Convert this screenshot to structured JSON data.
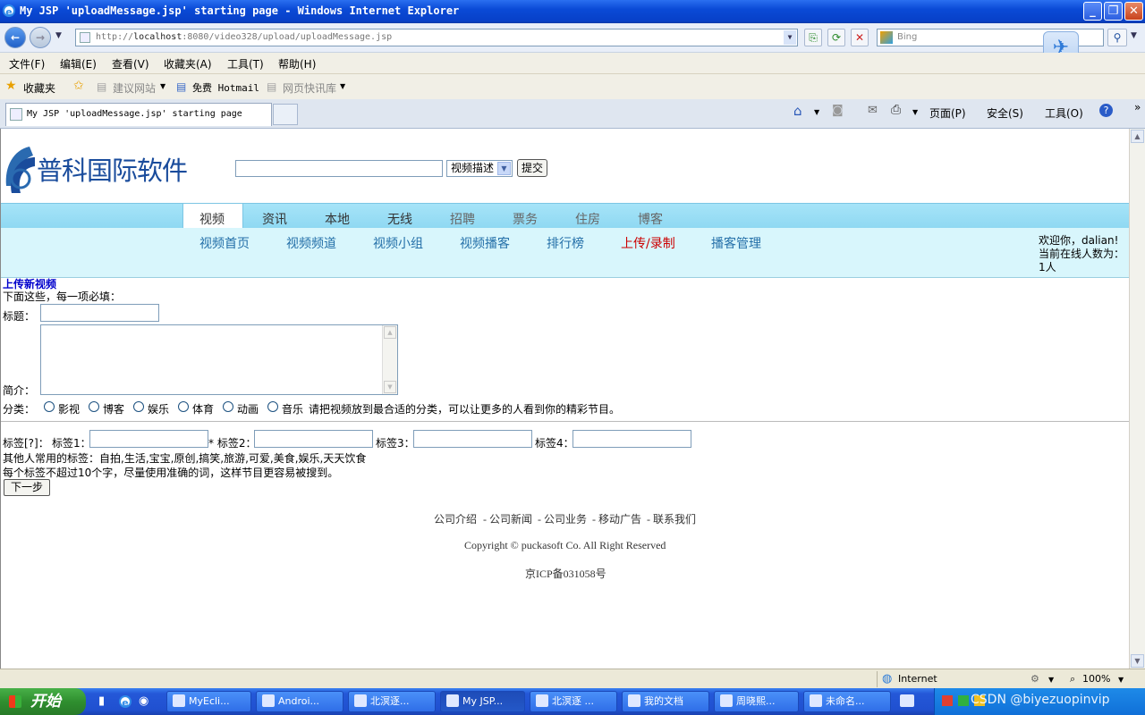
{
  "window": {
    "title": "My JSP 'uploadMessage.jsp' starting page - Windows Internet Explorer"
  },
  "address": {
    "url_prefix": "http://",
    "url_host": "localhost",
    "url_rest": ":8080/video328/upload/uploadMessage.jsp",
    "search_placeholder": "Bing"
  },
  "menubar": [
    "文件(F)",
    "编辑(E)",
    "查看(V)",
    "收藏夹(A)",
    "工具(T)",
    "帮助(H)"
  ],
  "favbar": {
    "favorites": "收藏夹",
    "suggested": "建议网站",
    "hotmail": "免费 Hotmail",
    "webslice": "网页快讯库"
  },
  "tab": {
    "title": "My JSP 'uploadMessage.jsp' starting page"
  },
  "cmdbar": {
    "page": "页面(P)",
    "safety": "安全(S)",
    "tools": "工具(O)"
  },
  "site": {
    "logo_text": "普科国际软件",
    "search_select": "视频描述",
    "search_submit": "提交",
    "main_nav": [
      "视频",
      "资讯",
      "本地",
      "无线",
      "招聘",
      "票务",
      "住房",
      "博客"
    ],
    "sub_nav": [
      "视频首页",
      "视频频道",
      "视频小组",
      "视频播客",
      "排行榜",
      "上传/录制",
      "播客管理"
    ],
    "welcome": "欢迎你，dalian! 当前在线人数为：1人",
    "colors": {
      "nav_band": "#96dcf4",
      "sub_band": "#d8f6fc",
      "sub_link": "#236fa8",
      "sub_active": "#cc0000",
      "heading": "#0000cc"
    }
  },
  "form": {
    "heading": "上传新视频",
    "note": "下面这些，每一项必填：",
    "title_label": "标题：",
    "intro_label": "简介：",
    "category_label": "分类：",
    "categories": [
      "影视",
      "博客",
      "娱乐",
      "体育",
      "动画",
      "音乐"
    ],
    "category_hint": "请把视频放到最合适的分类，可以让更多的人看到你的精彩节目。",
    "tags_label": "标签[?]：",
    "tag_labels": [
      "标签1：",
      "* 标签2：",
      "标签3：",
      "标签4："
    ],
    "common_tags": "其他人常用的标签：自拍,生活,宝宝,原创,搞笑,旅游,可爱,美食,娱乐,天天饮食",
    "tag_hint": "每个标签不超过10个字，尽量使用准确的词，这样节目更容易被搜到。",
    "next_button": "下一步"
  },
  "footer": {
    "links": [
      "公司介绍",
      "- 公司新闻",
      "- 公司业务",
      "- 移动广告",
      "- 联系我们"
    ],
    "copyright": "Copyright © puckasoft Co. All Right Reserved",
    "icp": "京ICP备031058号"
  },
  "statusbar": {
    "zone": "Internet",
    "zoom": "100%"
  },
  "taskbar": {
    "start": "开始",
    "tasks": [
      "MyEcli...",
      "Androi...",
      "北溟逐...",
      "My JSP...",
      "北溟逐 ...",
      "我的文档",
      "周晓熙...",
      "未命名..."
    ],
    "watermark": "CSDN @biyezuopinvip"
  }
}
